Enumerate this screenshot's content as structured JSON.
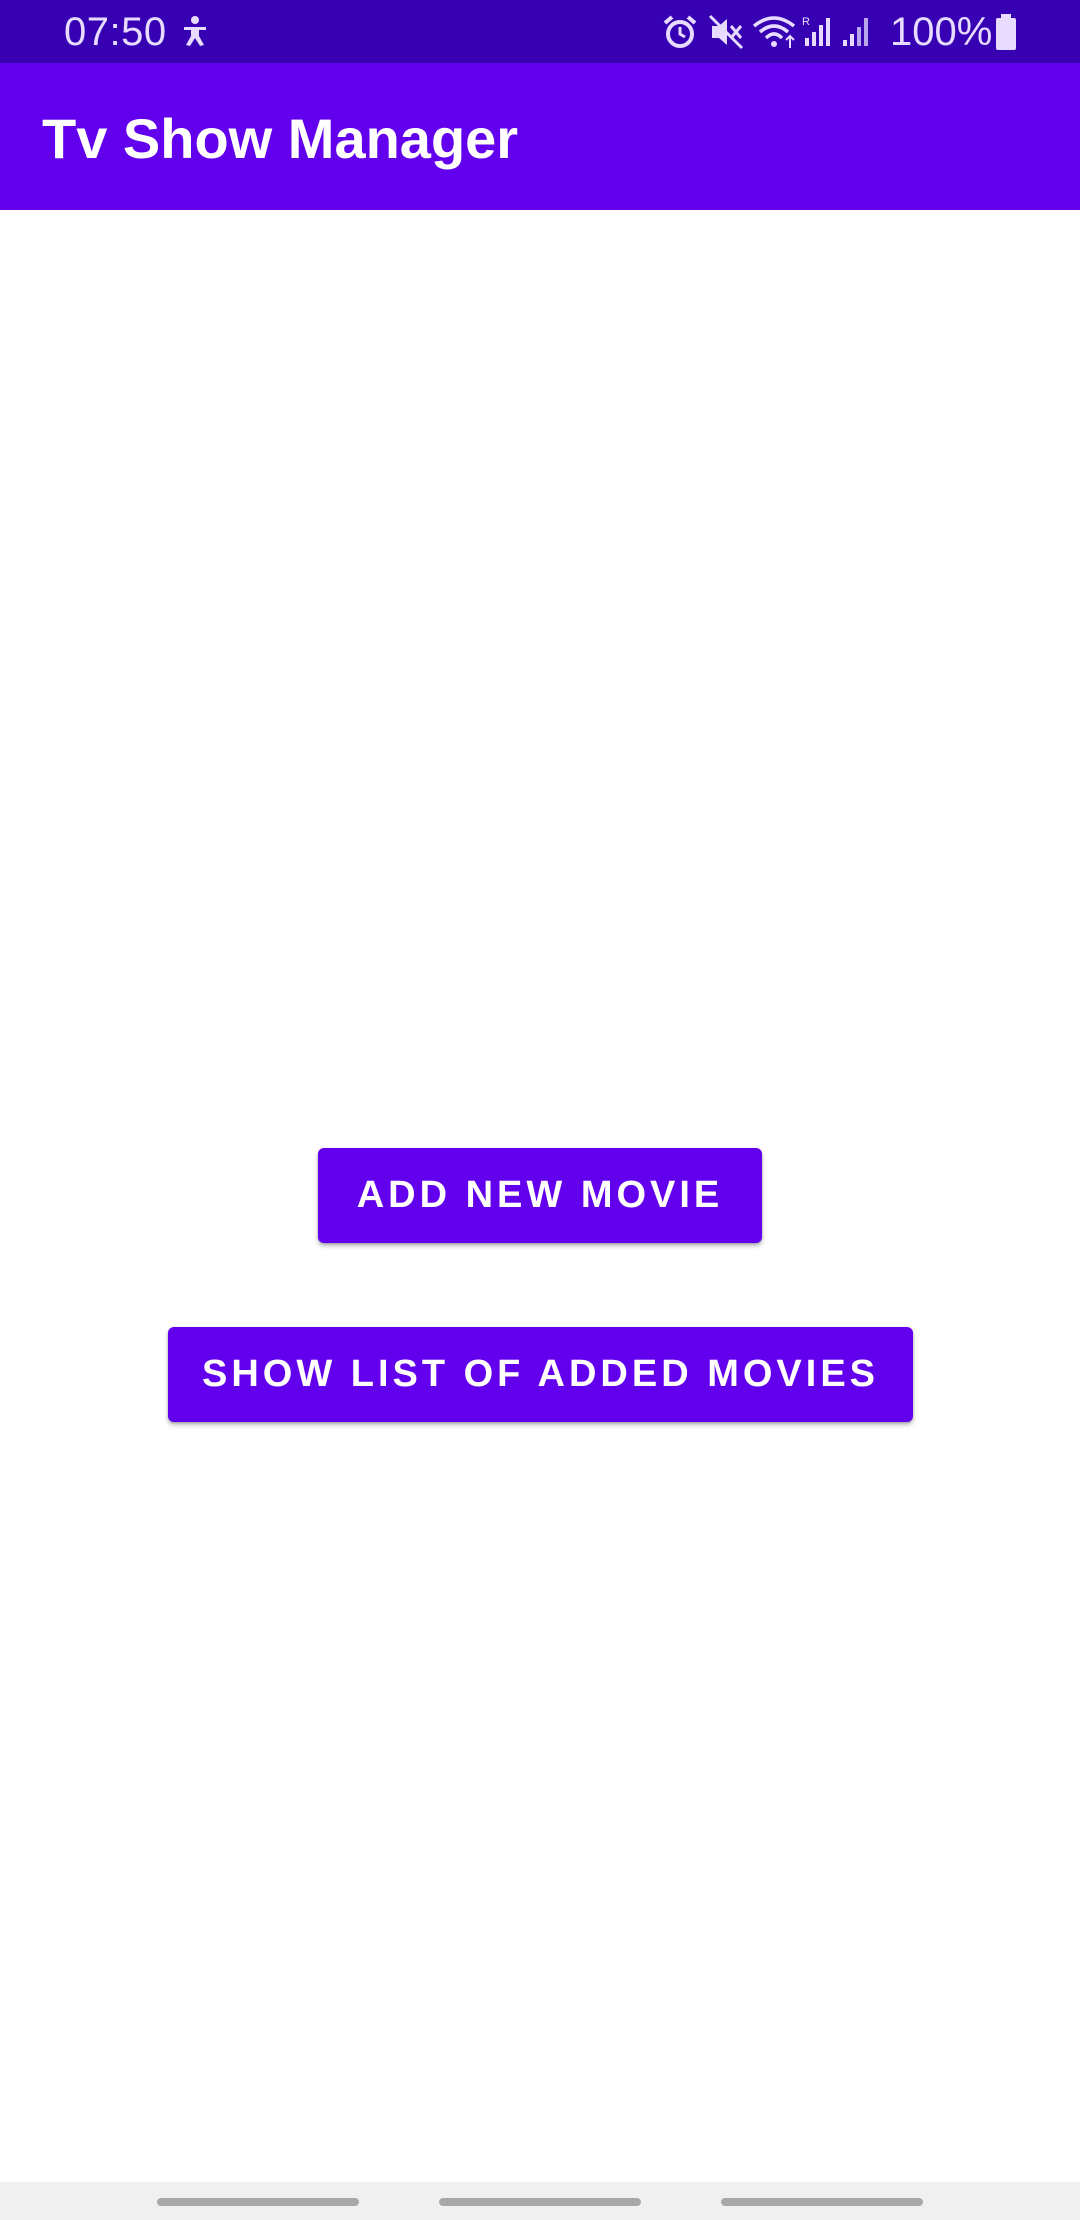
{
  "status_bar": {
    "time": "07:50",
    "battery": "100%",
    "icons": [
      "accessibility-icon",
      "alarm-icon",
      "mute-icon",
      "wifi-icon",
      "signal-icon",
      "signal-icon",
      "battery-icon"
    ]
  },
  "app_bar": {
    "title": "Tv Show Manager"
  },
  "main": {
    "add_button_label": "ADD NEW MOVIE",
    "list_button_label": "SHOW LIST OF ADDED MOVIES"
  },
  "colors": {
    "primary": "#6200ee",
    "primary_dark": "#3700b3",
    "on_primary": "#ffffff"
  }
}
